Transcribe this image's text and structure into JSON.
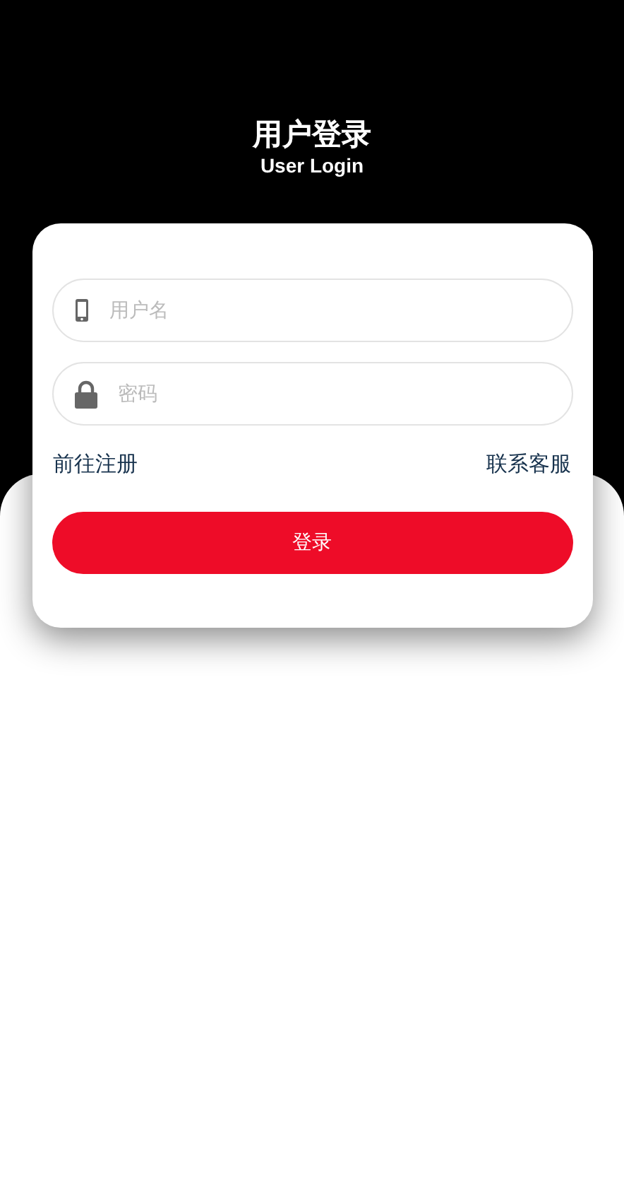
{
  "header": {
    "title": "用户登录",
    "subtitle": "User Login"
  },
  "fields": [
    {
      "kind": "phone",
      "placeholder": "用户名"
    },
    {
      "kind": "lock",
      "placeholder": "密码"
    }
  ],
  "links": [
    "前往注册",
    "联系客服"
  ],
  "submit": "登录"
}
